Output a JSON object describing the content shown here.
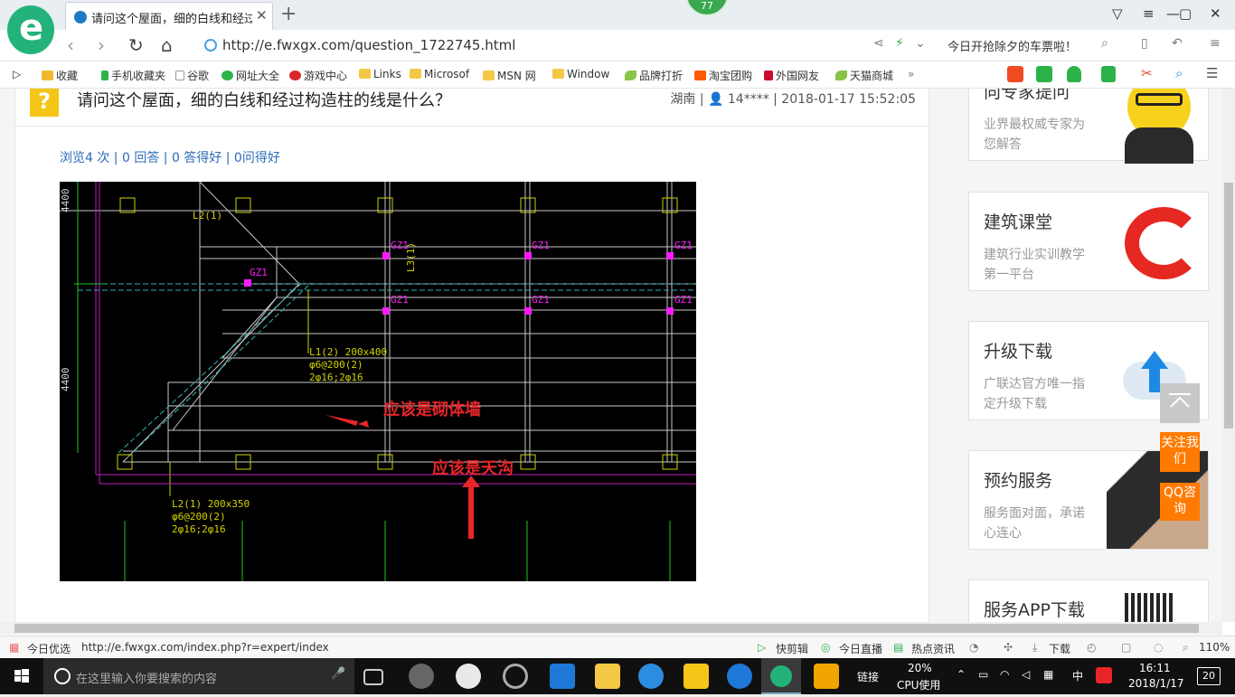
{
  "browser": {
    "tab_title": "请问这个屋面，细的白线和经过构造柱的线是什么？",
    "badge_count": "77",
    "url": "http://e.fwxgx.com/question_1722745.html",
    "promo_text": "今日开抢除夕的车票啦！"
  },
  "bookmarks": [
    {
      "label": "收藏",
      "icon": "star-icon"
    },
    {
      "label": "手机收藏夹",
      "icon": "phone-icon"
    },
    {
      "label": "谷歌",
      "icon": "page-icon"
    },
    {
      "label": "网址大全",
      "icon": "globe-icon"
    },
    {
      "label": "游戏中心",
      "icon": "game-icon"
    },
    {
      "label": "Links",
      "icon": "folder-icon"
    },
    {
      "label": "Microsof",
      "icon": "folder-icon"
    },
    {
      "label": "MSN 网",
      "icon": "folder-icon"
    },
    {
      "label": "Window",
      "icon": "folder-icon"
    },
    {
      "label": "品牌打折",
      "icon": "leaf-icon"
    },
    {
      "label": "淘宝团购",
      "icon": "taobao-icon"
    },
    {
      "label": "外国网友",
      "icon": "flag-icon"
    },
    {
      "label": "天猫商城",
      "icon": "leaf-icon"
    }
  ],
  "question": {
    "title": "请问这个屋面，细的白线和经过构造柱的线是什么？",
    "meta": "湖南 | 👤 14**** | 2018-01-17 15:52:05",
    "stats": "浏览4 次 | 0 回答 | 0 答得好 | 0问得好"
  },
  "drawing": {
    "dim_top": "4400",
    "dim_mid": "4400",
    "labels": [
      "GZ1",
      "GZ1",
      "GZ1",
      "GZ1",
      "GZ1",
      "GZ1",
      "GZ1"
    ],
    "beam_l2_top": "L2(1)",
    "beam_l3": "L3(1)",
    "beam_l1": [
      "L1(2) 200x400",
      "φ6@200(2)",
      "2φ16;2φ16"
    ],
    "beam_l2": [
      "L2(1) 200x350",
      "φ6@200(2)",
      "2φ16;2φ16"
    ],
    "annotation_wall": "应该是砌体墙",
    "annotation_gutter": "应该是天沟"
  },
  "sidebar": {
    "expert": {
      "title": "向专家提问",
      "desc": "业界最权威专家为您解答"
    },
    "classroom": {
      "title": "建筑课堂",
      "desc": "建筑行业实训教学第一平台"
    },
    "upgrade": {
      "title": "升级下载",
      "desc": "广联达官方唯一指定升级下载"
    },
    "booking": {
      "title": "预约服务",
      "desc": "服务面对面，承诺心连心"
    },
    "app": {
      "title": "服务APP下载"
    },
    "follow_label": "关注我们",
    "qq_label": "QQ咨询"
  },
  "statusbar": {
    "left_label": "今日优选",
    "hover_url": "http://e.fwxgx.com/index.php?r=expert/index",
    "quick_cut": "快剪辑",
    "live": "今日直播",
    "news": "热点资讯",
    "download": "下载",
    "zoom": "110%"
  },
  "taskbar": {
    "search_placeholder": "在这里输入你要搜索的内容",
    "link_label": "链接",
    "cpu_percent": "20%",
    "cpu_label": "CPU使用",
    "ime": "中",
    "time": "16:11",
    "date": "2018/1/17",
    "notify_count": "20"
  },
  "colors": {
    "accent": "#23b37a",
    "link": "#2b6cb7",
    "orange": "#ff7a00",
    "annotation": "#e8262a"
  }
}
